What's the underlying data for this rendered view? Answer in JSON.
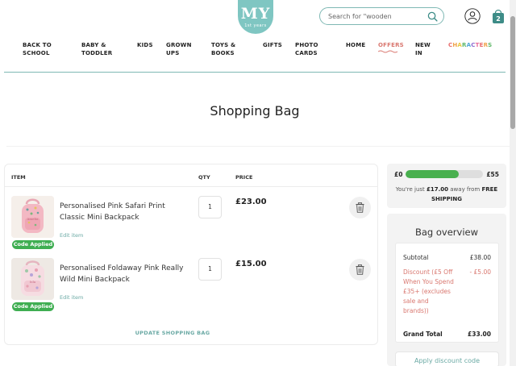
{
  "header": {
    "logo_text": "MY",
    "logo_sub": "1st years",
    "search_placeholder": "Search for \"wooden",
    "bag_count": "2"
  },
  "nav": {
    "items": [
      {
        "label1": "BACK TO",
        "label2": "SCHOOL"
      },
      {
        "label1": "BABY &",
        "label2": "TODDLER"
      },
      {
        "label1": "KIDS",
        "label2": ""
      },
      {
        "label1": "GROWN",
        "label2": "UPS"
      },
      {
        "label1": "TOYS &",
        "label2": "BOOKS"
      },
      {
        "label1": "GIFTS",
        "label2": ""
      },
      {
        "label1": "PHOTO",
        "label2": "CARDS"
      },
      {
        "label1": "HOME",
        "label2": ""
      },
      {
        "label1": "OFFERS",
        "label2": ""
      },
      {
        "label1": "NEW",
        "label2": "IN"
      },
      {
        "label1": "CHARACTERS",
        "label2": ""
      }
    ],
    "characters_colors": [
      "#e86a6a",
      "#f0a24a",
      "#e9c83f",
      "#5fb86a",
      "#4fa8d8",
      "#8a6ad0",
      "#e86a9a",
      "#e86a6a",
      "#f0a24a",
      "#5fb86a"
    ]
  },
  "page": {
    "title": "Shopping Bag"
  },
  "cart": {
    "headers": {
      "item": "ITEM",
      "qty": "QTY",
      "price": "PRICE"
    },
    "items": [
      {
        "name": "Personalised Pink Safari Print Classic Mini Backpack",
        "edit": "Edit item",
        "badge": "Code Applied",
        "qty": "1",
        "price": "£23.00"
      },
      {
        "name": "Personalised Foldaway Pink Really Wild Mini Backpack",
        "edit": "Edit item",
        "badge": "Code Applied",
        "qty": "1",
        "price": "£15.00"
      }
    ],
    "update_label": "UPDATE SHOPPING BAG"
  },
  "shipping": {
    "min": "£0",
    "max": "£55",
    "progress": 0.69,
    "msg_pre": "You're just ",
    "msg_amount": "£17.00",
    "msg_mid": " away from ",
    "msg_free": "FREE SHIPPING"
  },
  "overview": {
    "title": "Bag overview",
    "subtotal_label": "Subtotal",
    "subtotal_value": "£38.00",
    "discount_label": "Discount (£5 Off When You Spend £35+ (excludes sale and brands))",
    "discount_value": "- £5.00",
    "grand_total_label": "Grand Total",
    "grand_total_value": "£33.00",
    "apply_label": "Apply discount code"
  },
  "colors": {
    "teal": "#7fc6c2",
    "green": "#3fae52",
    "offer": "#d9776f"
  }
}
